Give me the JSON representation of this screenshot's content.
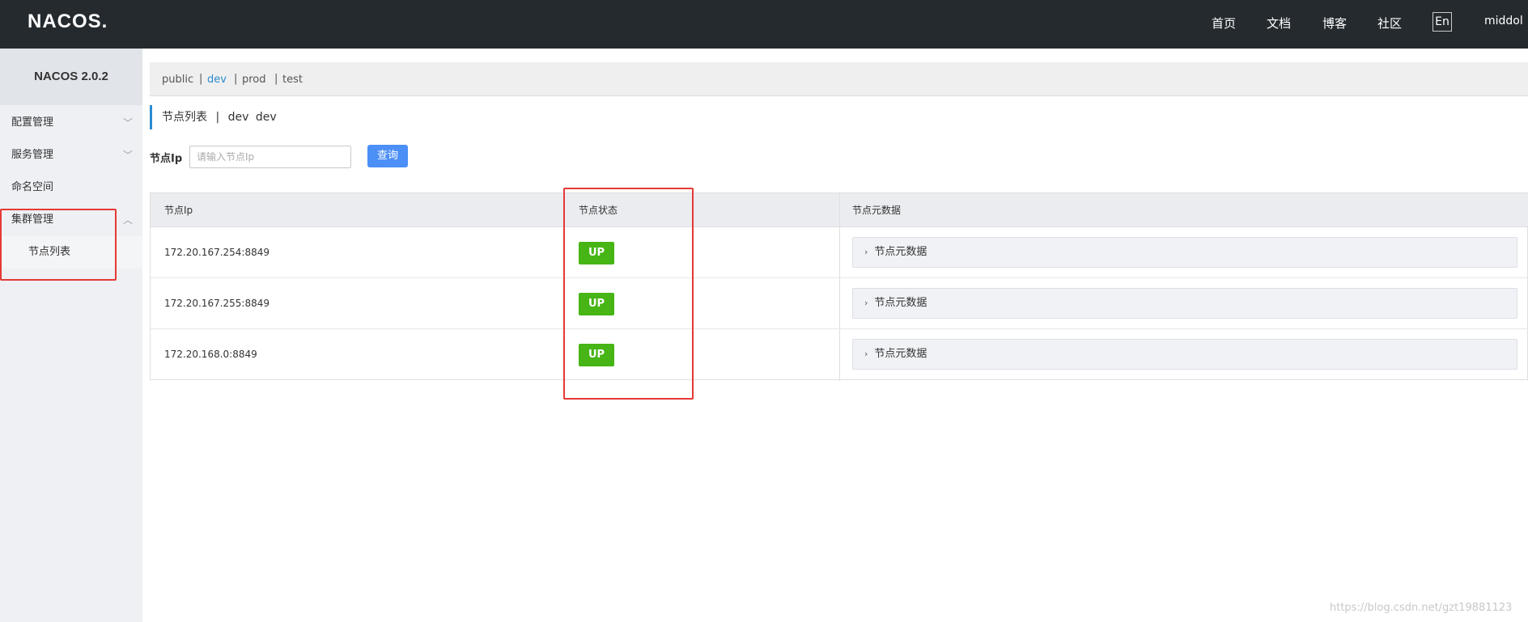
{
  "header": {
    "logo": "NACOS.",
    "nav": [
      "首页",
      "文档",
      "博客",
      "社区"
    ],
    "lang": "En",
    "user": "middol"
  },
  "sidebar": {
    "brand": "NACOS 2.0.2",
    "items": [
      {
        "label": "配置管理",
        "expanded": false
      },
      {
        "label": "服务管理",
        "expanded": false
      },
      {
        "label": "命名空间"
      },
      {
        "label": "集群管理",
        "expanded": true
      },
      {
        "label": "节点列表",
        "sub": true
      }
    ]
  },
  "namespaces": {
    "items": [
      "public",
      "dev",
      "prod",
      "test"
    ],
    "separator": "|",
    "active": "dev"
  },
  "page": {
    "title": "节点列表",
    "title_sep": "|",
    "namespace": "dev",
    "namespace_id": "dev"
  },
  "search": {
    "label": "节点Ip",
    "placeholder": "请输入节点Ip",
    "button": "查询"
  },
  "table": {
    "headers": [
      "节点Ip",
      "节点状态",
      "节点元数据"
    ],
    "rows": [
      {
        "ip": "172.20.167.254:8849",
        "status": "UP",
        "meta": "节点元数据"
      },
      {
        "ip": "172.20.167.255:8849",
        "status": "UP",
        "meta": "节点元数据"
      },
      {
        "ip": "172.20.168.0:8849",
        "status": "UP",
        "meta": "节点元数据"
      }
    ]
  },
  "colors": {
    "topbar": "#252a2f",
    "sidebar": "#eef0f4",
    "accent": "#2b8bd1",
    "button": "#4c8ff7",
    "status_up": "#46b515",
    "annotation": "#e53935"
  },
  "watermark": "https://blog.csdn.net/gzt19881123"
}
